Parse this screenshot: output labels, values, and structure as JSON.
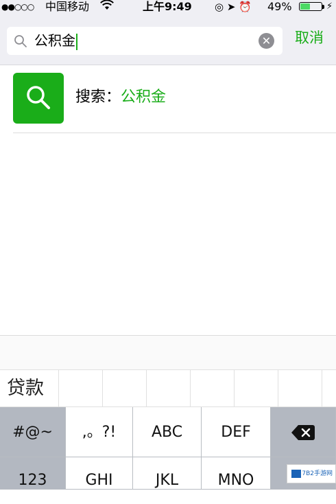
{
  "status_bar": {
    "signal": "●●○○○",
    "carrier": "中国移动",
    "wifi_icon": "wifi-icon",
    "time": "上午9:49",
    "icons": "◎ ➤ ⏰",
    "battery_percent": "49%",
    "battery_level": 0.49,
    "charging_icon": "⚡"
  },
  "search": {
    "value": "公积金",
    "clear_icon": "✕",
    "cancel_label": "取消"
  },
  "result": {
    "prefix": "搜索：",
    "keyword": "公积金"
  },
  "predictive": {
    "word": "贷款"
  },
  "keyboard": {
    "row1": {
      "symbols": "#@~",
      "punct": ",。?!",
      "abc": "ABC",
      "def": "DEF",
      "delete_icon": "delete-icon"
    },
    "row2": {
      "num": "123",
      "ghi": "GHI",
      "jkl": "JKL",
      "mno": "MNO"
    }
  },
  "watermark": {
    "text": "7B2手游网"
  },
  "colors": {
    "accent": "#1aad19",
    "bar_bg": "#efeff4",
    "key_dark": "#b3b8c1"
  }
}
